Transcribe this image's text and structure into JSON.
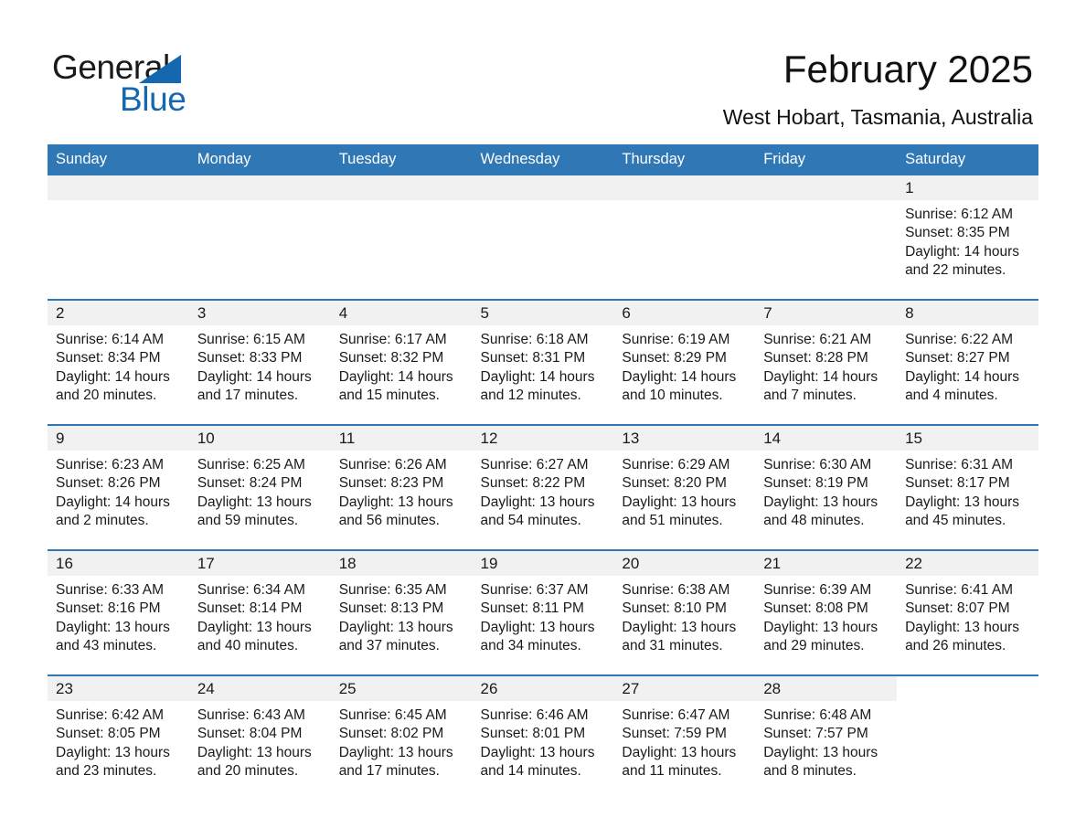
{
  "brand": {
    "name_part1": "General",
    "name_part2": "Blue"
  },
  "header": {
    "title": "February 2025",
    "location": "West Hobart, Tasmania, Australia"
  },
  "colors": {
    "header_blue": "#2f77b5",
    "brand_blue": "#1568b0",
    "daynum_band": "#f1f1f1",
    "text": "#1a1a1a"
  },
  "weekdays": [
    "Sunday",
    "Monday",
    "Tuesday",
    "Wednesday",
    "Thursday",
    "Friday",
    "Saturday"
  ],
  "weeks": [
    [
      {
        "day": "",
        "sunrise": "",
        "sunset": "",
        "daylight_line1": "",
        "daylight_line2": "",
        "blank": true,
        "void": false
      },
      {
        "day": "",
        "sunrise": "",
        "sunset": "",
        "daylight_line1": "",
        "daylight_line2": "",
        "blank": true,
        "void": false
      },
      {
        "day": "",
        "sunrise": "",
        "sunset": "",
        "daylight_line1": "",
        "daylight_line2": "",
        "blank": true,
        "void": false
      },
      {
        "day": "",
        "sunrise": "",
        "sunset": "",
        "daylight_line1": "",
        "daylight_line2": "",
        "blank": true,
        "void": false
      },
      {
        "day": "",
        "sunrise": "",
        "sunset": "",
        "daylight_line1": "",
        "daylight_line2": "",
        "blank": true,
        "void": false
      },
      {
        "day": "",
        "sunrise": "",
        "sunset": "",
        "daylight_line1": "",
        "daylight_line2": "",
        "blank": true,
        "void": false
      },
      {
        "day": "1",
        "sunrise": "Sunrise: 6:12 AM",
        "sunset": "Sunset: 8:35 PM",
        "daylight_line1": "Daylight: 14 hours",
        "daylight_line2": "and 22 minutes.",
        "blank": false,
        "void": false
      }
    ],
    [
      {
        "day": "2",
        "sunrise": "Sunrise: 6:14 AM",
        "sunset": "Sunset: 8:34 PM",
        "daylight_line1": "Daylight: 14 hours",
        "daylight_line2": "and 20 minutes.",
        "blank": false,
        "void": false
      },
      {
        "day": "3",
        "sunrise": "Sunrise: 6:15 AM",
        "sunset": "Sunset: 8:33 PM",
        "daylight_line1": "Daylight: 14 hours",
        "daylight_line2": "and 17 minutes.",
        "blank": false,
        "void": false
      },
      {
        "day": "4",
        "sunrise": "Sunrise: 6:17 AM",
        "sunset": "Sunset: 8:32 PM",
        "daylight_line1": "Daylight: 14 hours",
        "daylight_line2": "and 15 minutes.",
        "blank": false,
        "void": false
      },
      {
        "day": "5",
        "sunrise": "Sunrise: 6:18 AM",
        "sunset": "Sunset: 8:31 PM",
        "daylight_line1": "Daylight: 14 hours",
        "daylight_line2": "and 12 minutes.",
        "blank": false,
        "void": false
      },
      {
        "day": "6",
        "sunrise": "Sunrise: 6:19 AM",
        "sunset": "Sunset: 8:29 PM",
        "daylight_line1": "Daylight: 14 hours",
        "daylight_line2": "and 10 minutes.",
        "blank": false,
        "void": false
      },
      {
        "day": "7",
        "sunrise": "Sunrise: 6:21 AM",
        "sunset": "Sunset: 8:28 PM",
        "daylight_line1": "Daylight: 14 hours",
        "daylight_line2": "and 7 minutes.",
        "blank": false,
        "void": false
      },
      {
        "day": "8",
        "sunrise": "Sunrise: 6:22 AM",
        "sunset": "Sunset: 8:27 PM",
        "daylight_line1": "Daylight: 14 hours",
        "daylight_line2": "and 4 minutes.",
        "blank": false,
        "void": false
      }
    ],
    [
      {
        "day": "9",
        "sunrise": "Sunrise: 6:23 AM",
        "sunset": "Sunset: 8:26 PM",
        "daylight_line1": "Daylight: 14 hours",
        "daylight_line2": "and 2 minutes.",
        "blank": false,
        "void": false
      },
      {
        "day": "10",
        "sunrise": "Sunrise: 6:25 AM",
        "sunset": "Sunset: 8:24 PM",
        "daylight_line1": "Daylight: 13 hours",
        "daylight_line2": "and 59 minutes.",
        "blank": false,
        "void": false
      },
      {
        "day": "11",
        "sunrise": "Sunrise: 6:26 AM",
        "sunset": "Sunset: 8:23 PM",
        "daylight_line1": "Daylight: 13 hours",
        "daylight_line2": "and 56 minutes.",
        "blank": false,
        "void": false
      },
      {
        "day": "12",
        "sunrise": "Sunrise: 6:27 AM",
        "sunset": "Sunset: 8:22 PM",
        "daylight_line1": "Daylight: 13 hours",
        "daylight_line2": "and 54 minutes.",
        "blank": false,
        "void": false
      },
      {
        "day": "13",
        "sunrise": "Sunrise: 6:29 AM",
        "sunset": "Sunset: 8:20 PM",
        "daylight_line1": "Daylight: 13 hours",
        "daylight_line2": "and 51 minutes.",
        "blank": false,
        "void": false
      },
      {
        "day": "14",
        "sunrise": "Sunrise: 6:30 AM",
        "sunset": "Sunset: 8:19 PM",
        "daylight_line1": "Daylight: 13 hours",
        "daylight_line2": "and 48 minutes.",
        "blank": false,
        "void": false
      },
      {
        "day": "15",
        "sunrise": "Sunrise: 6:31 AM",
        "sunset": "Sunset: 8:17 PM",
        "daylight_line1": "Daylight: 13 hours",
        "daylight_line2": "and 45 minutes.",
        "blank": false,
        "void": false
      }
    ],
    [
      {
        "day": "16",
        "sunrise": "Sunrise: 6:33 AM",
        "sunset": "Sunset: 8:16 PM",
        "daylight_line1": "Daylight: 13 hours",
        "daylight_line2": "and 43 minutes.",
        "blank": false,
        "void": false
      },
      {
        "day": "17",
        "sunrise": "Sunrise: 6:34 AM",
        "sunset": "Sunset: 8:14 PM",
        "daylight_line1": "Daylight: 13 hours",
        "daylight_line2": "and 40 minutes.",
        "blank": false,
        "void": false
      },
      {
        "day": "18",
        "sunrise": "Sunrise: 6:35 AM",
        "sunset": "Sunset: 8:13 PM",
        "daylight_line1": "Daylight: 13 hours",
        "daylight_line2": "and 37 minutes.",
        "blank": false,
        "void": false
      },
      {
        "day": "19",
        "sunrise": "Sunrise: 6:37 AM",
        "sunset": "Sunset: 8:11 PM",
        "daylight_line1": "Daylight: 13 hours",
        "daylight_line2": "and 34 minutes.",
        "blank": false,
        "void": false
      },
      {
        "day": "20",
        "sunrise": "Sunrise: 6:38 AM",
        "sunset": "Sunset: 8:10 PM",
        "daylight_line1": "Daylight: 13 hours",
        "daylight_line2": "and 31 minutes.",
        "blank": false,
        "void": false
      },
      {
        "day": "21",
        "sunrise": "Sunrise: 6:39 AM",
        "sunset": "Sunset: 8:08 PM",
        "daylight_line1": "Daylight: 13 hours",
        "daylight_line2": "and 29 minutes.",
        "blank": false,
        "void": false
      },
      {
        "day": "22",
        "sunrise": "Sunrise: 6:41 AM",
        "sunset": "Sunset: 8:07 PM",
        "daylight_line1": "Daylight: 13 hours",
        "daylight_line2": "and 26 minutes.",
        "blank": false,
        "void": false
      }
    ],
    [
      {
        "day": "23",
        "sunrise": "Sunrise: 6:42 AM",
        "sunset": "Sunset: 8:05 PM",
        "daylight_line1": "Daylight: 13 hours",
        "daylight_line2": "and 23 minutes.",
        "blank": false,
        "void": false
      },
      {
        "day": "24",
        "sunrise": "Sunrise: 6:43 AM",
        "sunset": "Sunset: 8:04 PM",
        "daylight_line1": "Daylight: 13 hours",
        "daylight_line2": "and 20 minutes.",
        "blank": false,
        "void": false
      },
      {
        "day": "25",
        "sunrise": "Sunrise: 6:45 AM",
        "sunset": "Sunset: 8:02 PM",
        "daylight_line1": "Daylight: 13 hours",
        "daylight_line2": "and 17 minutes.",
        "blank": false,
        "void": false
      },
      {
        "day": "26",
        "sunrise": "Sunrise: 6:46 AM",
        "sunset": "Sunset: 8:01 PM",
        "daylight_line1": "Daylight: 13 hours",
        "daylight_line2": "and 14 minutes.",
        "blank": false,
        "void": false
      },
      {
        "day": "27",
        "sunrise": "Sunrise: 6:47 AM",
        "sunset": "Sunset: 7:59 PM",
        "daylight_line1": "Daylight: 13 hours",
        "daylight_line2": "and 11 minutes.",
        "blank": false,
        "void": false
      },
      {
        "day": "28",
        "sunrise": "Sunrise: 6:48 AM",
        "sunset": "Sunset: 7:57 PM",
        "daylight_line1": "Daylight: 13 hours",
        "daylight_line2": "and 8 minutes.",
        "blank": false,
        "void": false
      },
      {
        "day": "",
        "sunrise": "",
        "sunset": "",
        "daylight_line1": "",
        "daylight_line2": "",
        "blank": true,
        "void": true
      }
    ]
  ]
}
